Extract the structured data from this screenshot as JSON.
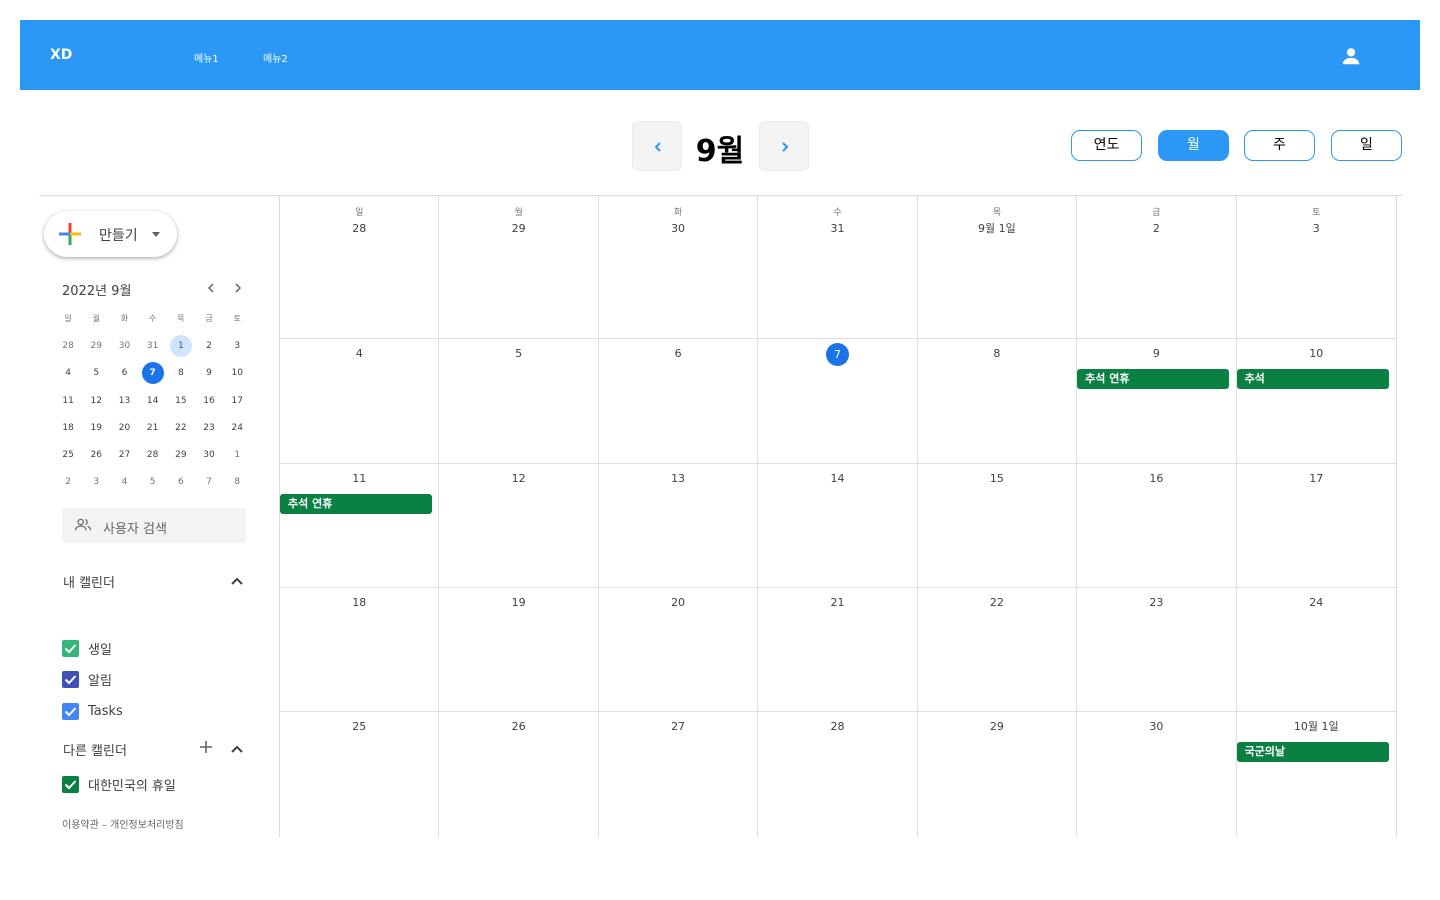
{
  "header": {
    "logo": "XD",
    "menu1": "메뉴1",
    "menu2": "메뉴2",
    "accent": "#2b98f6"
  },
  "toolbar": {
    "month_title": "9월",
    "views": [
      "연도",
      "월",
      "주",
      "일"
    ],
    "active_view": "월"
  },
  "sidebar": {
    "create_label": "만들기",
    "mini_calendar": {
      "title": "2022년 9월",
      "dow": [
        "일",
        "월",
        "화",
        "수",
        "목",
        "금",
        "토"
      ],
      "weeks": [
        [
          "28",
          "29",
          "30",
          "31",
          "1",
          "2",
          "3"
        ],
        [
          "4",
          "5",
          "6",
          "7",
          "8",
          "9",
          "10"
        ],
        [
          "11",
          "12",
          "13",
          "14",
          "15",
          "16",
          "17"
        ],
        [
          "18",
          "19",
          "20",
          "21",
          "22",
          "23",
          "24"
        ],
        [
          "25",
          "26",
          "27",
          "28",
          "29",
          "30",
          "1"
        ],
        [
          "2",
          "3",
          "4",
          "5",
          "6",
          "7",
          "8"
        ]
      ]
    },
    "search_placeholder": "사용자 검색",
    "my_calendars_title": "내 캘린더",
    "my_calendars": [
      {
        "label": "생일",
        "color": "#33b679"
      },
      {
        "label": "알림",
        "color": "#3f51b5"
      },
      {
        "label": "Tasks",
        "color": "#4285f4"
      }
    ],
    "other_calendars_title": "다른 캘린더",
    "other_calendars": [
      {
        "label": "대한민국의 휴일",
        "color": "#0b8043"
      }
    ],
    "footer": "이용약관 – 개인정보처리방침"
  },
  "month_grid": {
    "dow": [
      "일",
      "월",
      "화",
      "수",
      "목",
      "금",
      "토"
    ],
    "weeks": [
      [
        "28",
        "29",
        "30",
        "31",
        "9월 1일",
        "2",
        "3"
      ],
      [
        "4",
        "5",
        "6",
        "7",
        "8",
        "9",
        "10"
      ],
      [
        "11",
        "12",
        "13",
        "14",
        "15",
        "16",
        "17"
      ],
      [
        "18",
        "19",
        "20",
        "21",
        "22",
        "23",
        "24"
      ],
      [
        "25",
        "26",
        "27",
        "28",
        "29",
        "30",
        "10월 1일"
      ]
    ],
    "events": [
      {
        "week": 1,
        "day": 5,
        "label": "추석 연휴"
      },
      {
        "week": 1,
        "day": 6,
        "label": "추석"
      },
      {
        "week": 2,
        "day": 0,
        "label": "추석 연휴"
      },
      {
        "week": 4,
        "day": 6,
        "label": "국군의날"
      }
    ],
    "event_color": "#0b8043"
  }
}
